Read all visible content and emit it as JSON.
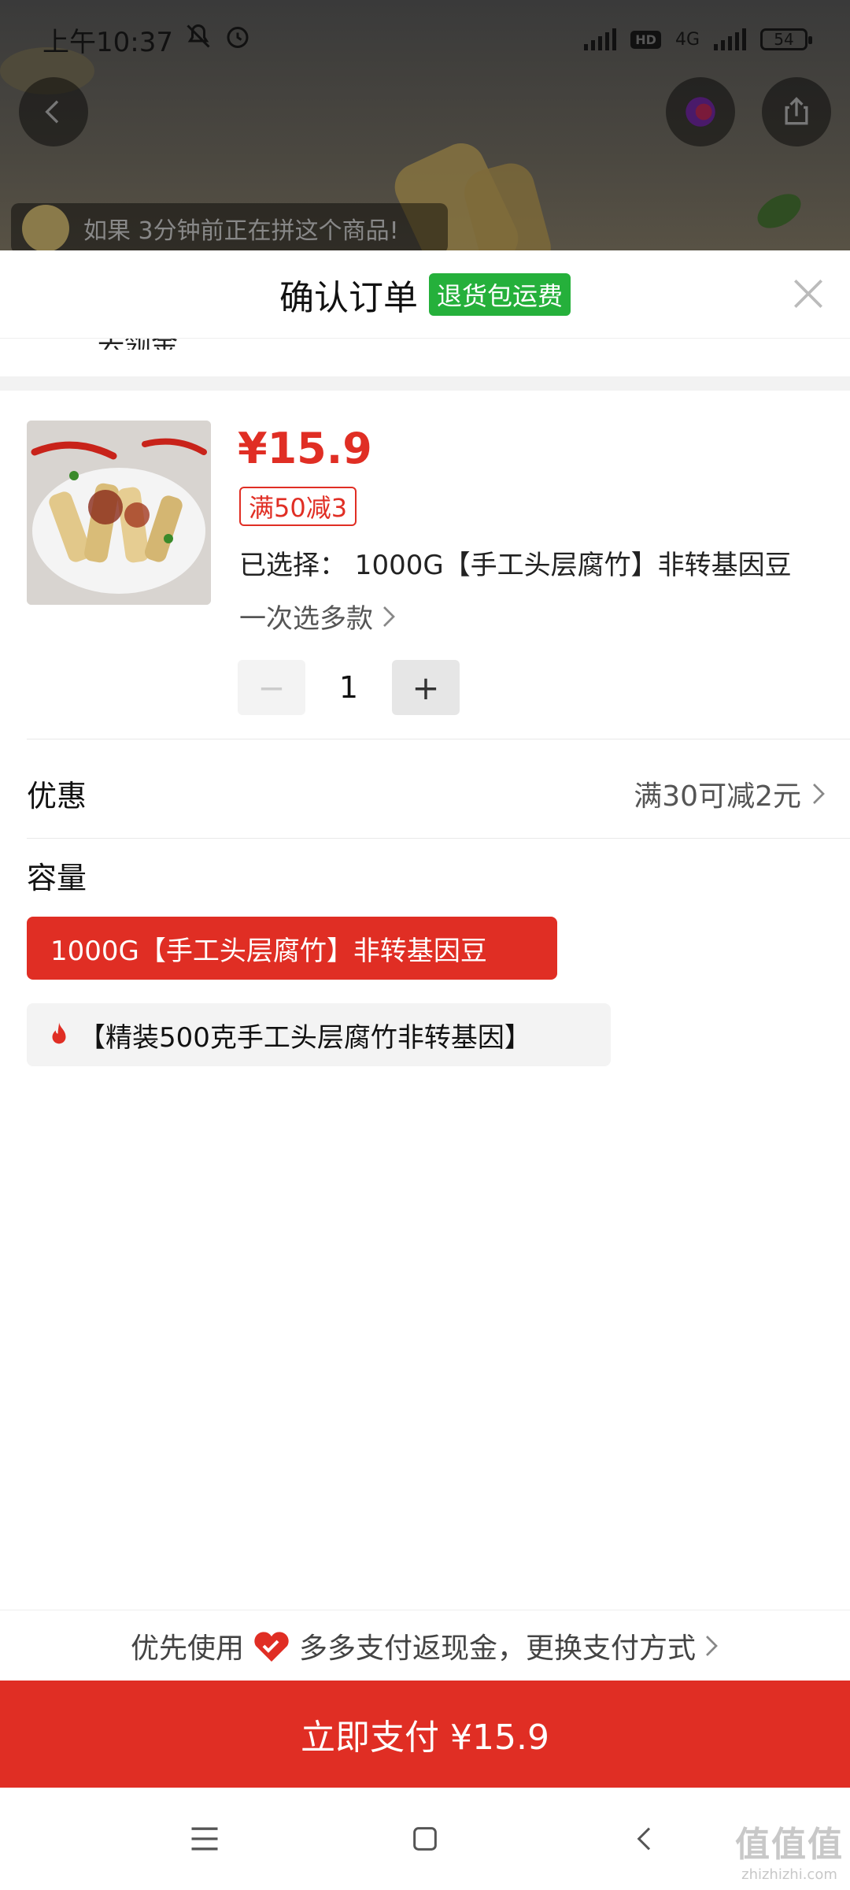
{
  "status_bar": {
    "time": "上午10:37",
    "battery": "54",
    "network": "4G",
    "hd": "HD"
  },
  "background": {
    "notice_text": "如果 3分钟前正在拼这个商品!"
  },
  "sheet": {
    "title": "确认订单",
    "badge": "退货包运费",
    "cut_text": "去领金"
  },
  "product": {
    "price": "¥15.9",
    "coupon": "满50减3",
    "selected": "已选择： 1000G【手工头层腐竹】非转基因豆",
    "multi_select": "一次选多款",
    "quantity": "1",
    "minus": "−",
    "plus": "+"
  },
  "discount": {
    "label": "优惠",
    "value": "满30可减2元"
  },
  "capacity": {
    "label": "容量",
    "options": [
      {
        "label": "1000G【手工头层腐竹】非转基因豆",
        "selected": true
      },
      {
        "label": "【精装500克手工头层腐竹非转基因】",
        "selected": false,
        "icon": "fire-icon"
      }
    ]
  },
  "payment": {
    "prefix": "优先使用",
    "method": "多多支付返现金，更换支付方式",
    "button": "立即支付 ¥15.9"
  },
  "watermark": {
    "logo": "值值值",
    "url": "zhizhizhi.com"
  },
  "colors": {
    "accent": "#e02e24",
    "badge_green": "#25b03b"
  }
}
